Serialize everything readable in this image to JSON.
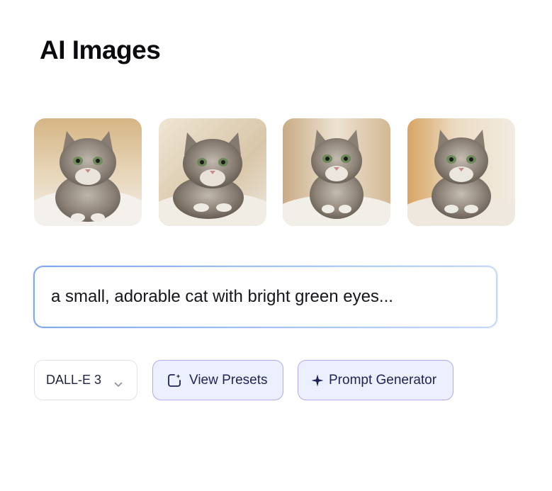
{
  "page": {
    "title": "AI Images"
  },
  "gallery": {
    "images": [
      {
        "alt": "fluffy gray kitten on white blanket"
      },
      {
        "alt": "fluffy gray kitten lying on cream blanket"
      },
      {
        "alt": "fluffy gray kitten sitting with paws forward"
      },
      {
        "alt": "fluffy gray kitten in warm light"
      }
    ]
  },
  "prompt": {
    "value": "a small, adorable cat with bright green eyes..."
  },
  "toolbar": {
    "model_value": "DALL-E 3",
    "presets_label": "View Presets",
    "generator_label": "Prompt Generator"
  },
  "colors": {
    "accent_border": "#b3aaf0",
    "pill_background": "#eceffd",
    "prompt_border": "#7fa8f0",
    "icon": "chevron-down-icon"
  }
}
